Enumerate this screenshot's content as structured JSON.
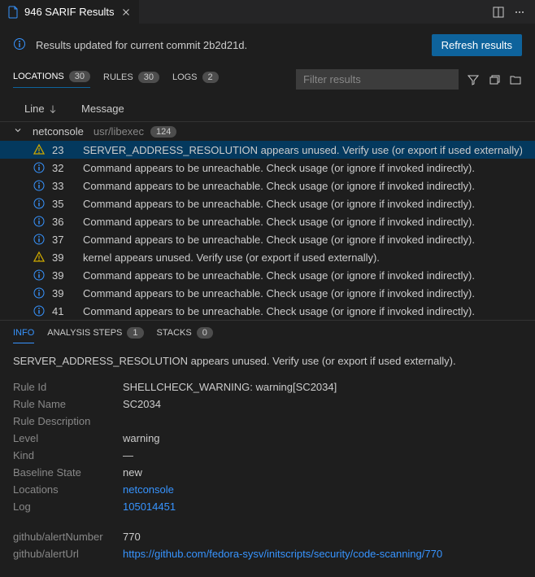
{
  "tab": {
    "title": "946 SARIF Results"
  },
  "banner": {
    "text": "Results updated for current commit 2b2d21d.",
    "refresh_label": "Refresh results"
  },
  "toolbar": {
    "tabs": [
      {
        "label": "LOCATIONS",
        "count": "30"
      },
      {
        "label": "RULES",
        "count": "30"
      },
      {
        "label": "LOGS",
        "count": "2"
      }
    ],
    "filter_placeholder": "Filter results"
  },
  "columns": {
    "line": "Line",
    "message": "Message"
  },
  "group": {
    "file": "netconsole",
    "path": "usr/libexec",
    "count": "124"
  },
  "results": [
    {
      "severity": "warning",
      "line": "23",
      "msg": "SERVER_ADDRESS_RESOLUTION appears unused. Verify use (or export if used externally).",
      "selected": true
    },
    {
      "severity": "info",
      "line": "32",
      "msg": "Command appears to be unreachable. Check usage (or ignore if invoked indirectly)."
    },
    {
      "severity": "info",
      "line": "33",
      "msg": "Command appears to be unreachable. Check usage (or ignore if invoked indirectly)."
    },
    {
      "severity": "info",
      "line": "35",
      "msg": "Command appears to be unreachable. Check usage (or ignore if invoked indirectly)."
    },
    {
      "severity": "info",
      "line": "36",
      "msg": "Command appears to be unreachable. Check usage (or ignore if invoked indirectly)."
    },
    {
      "severity": "info",
      "line": "37",
      "msg": "Command appears to be unreachable. Check usage (or ignore if invoked indirectly)."
    },
    {
      "severity": "warning",
      "line": "39",
      "msg": "kernel appears unused. Verify use (or export if used externally)."
    },
    {
      "severity": "info",
      "line": "39",
      "msg": "Command appears to be unreachable. Check usage (or ignore if invoked indirectly)."
    },
    {
      "severity": "info",
      "line": "39",
      "msg": "Command appears to be unreachable. Check usage (or ignore if invoked indirectly)."
    },
    {
      "severity": "info",
      "line": "41",
      "msg": "Command appears to be unreachable. Check usage (or ignore if invoked indirectly)."
    }
  ],
  "detail_tabs": [
    {
      "label": "INFO"
    },
    {
      "label": "ANALYSIS STEPS",
      "count": "1"
    },
    {
      "label": "STACKS",
      "count": "0"
    }
  ],
  "detail": {
    "message": "SERVER_ADDRESS_RESOLUTION appears unused. Verify use (or export if used externally).",
    "rows": [
      {
        "key": "Rule Id",
        "val": "SHELLCHECK_WARNING: warning[SC2034]"
      },
      {
        "key": "Rule Name",
        "val": "SC2034"
      },
      {
        "key": "Rule Description",
        "val": ""
      },
      {
        "key": "Level",
        "val": "warning"
      },
      {
        "key": "Kind",
        "val": "—"
      },
      {
        "key": "Baseline State",
        "val": "new"
      },
      {
        "key": "Locations",
        "val": "netconsole",
        "link": true
      },
      {
        "key": "Log",
        "val": "105014451",
        "link": true
      }
    ],
    "extra_rows": [
      {
        "key": "github/alertNumber",
        "val": "770"
      },
      {
        "key": "github/alertUrl",
        "val": "https://github.com/fedora-sysv/initscripts/security/code-scanning/770",
        "link": true
      }
    ]
  }
}
